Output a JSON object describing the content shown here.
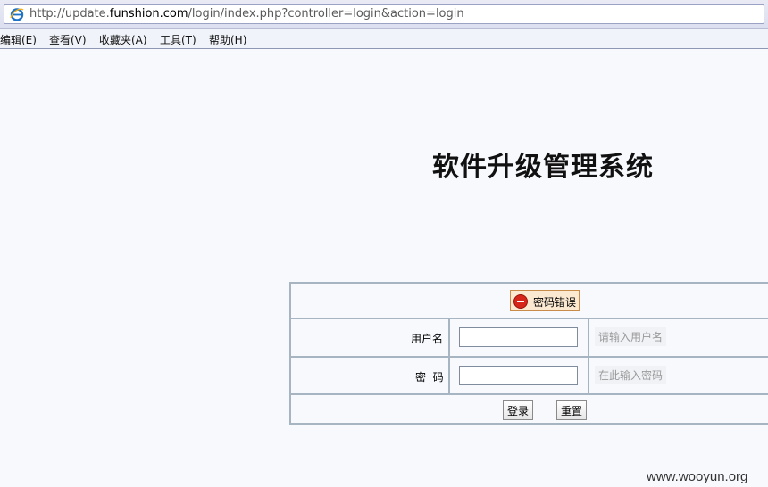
{
  "browser": {
    "url_prefix": "http://update.",
    "url_domain": "funshion.com",
    "url_path": "/login/index.php?controller=login&action=login"
  },
  "menu": [
    "编辑(E)",
    "查看(V)",
    "收藏夹(A)",
    "工具(T)",
    "帮助(H)"
  ],
  "page": {
    "title": "软件升级管理系统"
  },
  "login": {
    "error_message": "密码错误",
    "username_label": "用户名",
    "username_value": "",
    "username_hint": "请输入用户名",
    "password_label": "密  码",
    "password_value": "",
    "password_hint": "在此输入密码",
    "submit_label": "登录",
    "reset_label": "重置"
  },
  "watermark": "www.wooyun.org",
  "colors": {
    "border": "#a7b4c2",
    "error_bg": "#fbe9d2",
    "error_icon": "#d6261a"
  }
}
